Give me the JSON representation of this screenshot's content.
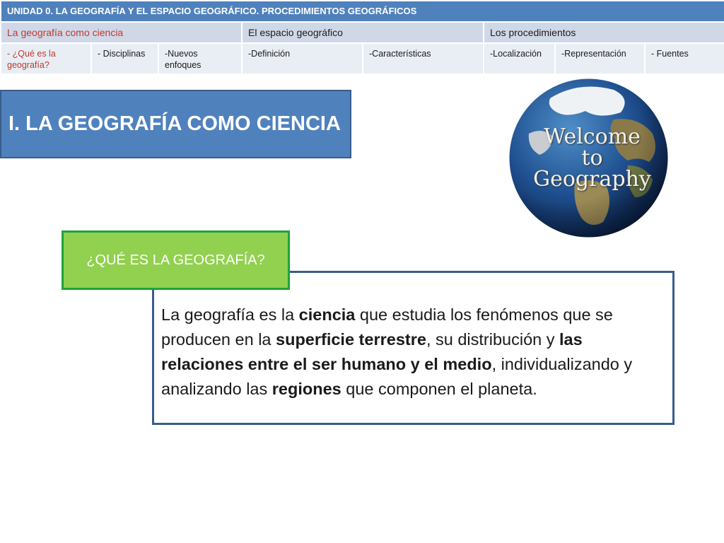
{
  "nav": {
    "title": "UNIDAD 0.  LA GEOGRAFÍA Y EL ESPACIO GEOGRÁFICO. PROCEDIMIENTOS GEOGRÁFICOS",
    "sections": [
      "La geografía como ciencia",
      "El espacio geográfico",
      "Los procedimientos"
    ],
    "subsections": [
      "-  ¿Qué es la geografía?",
      "- Disciplinas",
      "-Nuevos enfoques",
      "-Definición",
      "-Características",
      "-Localización",
      "-Representación",
      "- Fuentes"
    ],
    "active_color": "#c0392b"
  },
  "heading": "I. LA GEOGRAFÍA COMO CIENCIA",
  "globe": {
    "line1": "Welcome",
    "line2": "to",
    "line3": "Geography"
  },
  "question": "¿QUÉ ES LA GEOGRAFÍA?",
  "definition": {
    "t1": "La  geografía es la ",
    "b1": "ciencia",
    "t2": " que estudia los fenómenos que se producen en la ",
    "b2": "superficie terrestre",
    "t3": ", su distribución y ",
    "b3": "las relaciones entre el ser humano y el medio",
    "t4": ", individualizando y analizando las ",
    "b4": "regiones",
    "t5": " que componen el planeta."
  },
  "colors": {
    "title_bar": "#4f81bd",
    "section_bar": "#d0d8e8",
    "question_fill": "#92d050",
    "box_border": "#385d8a"
  }
}
